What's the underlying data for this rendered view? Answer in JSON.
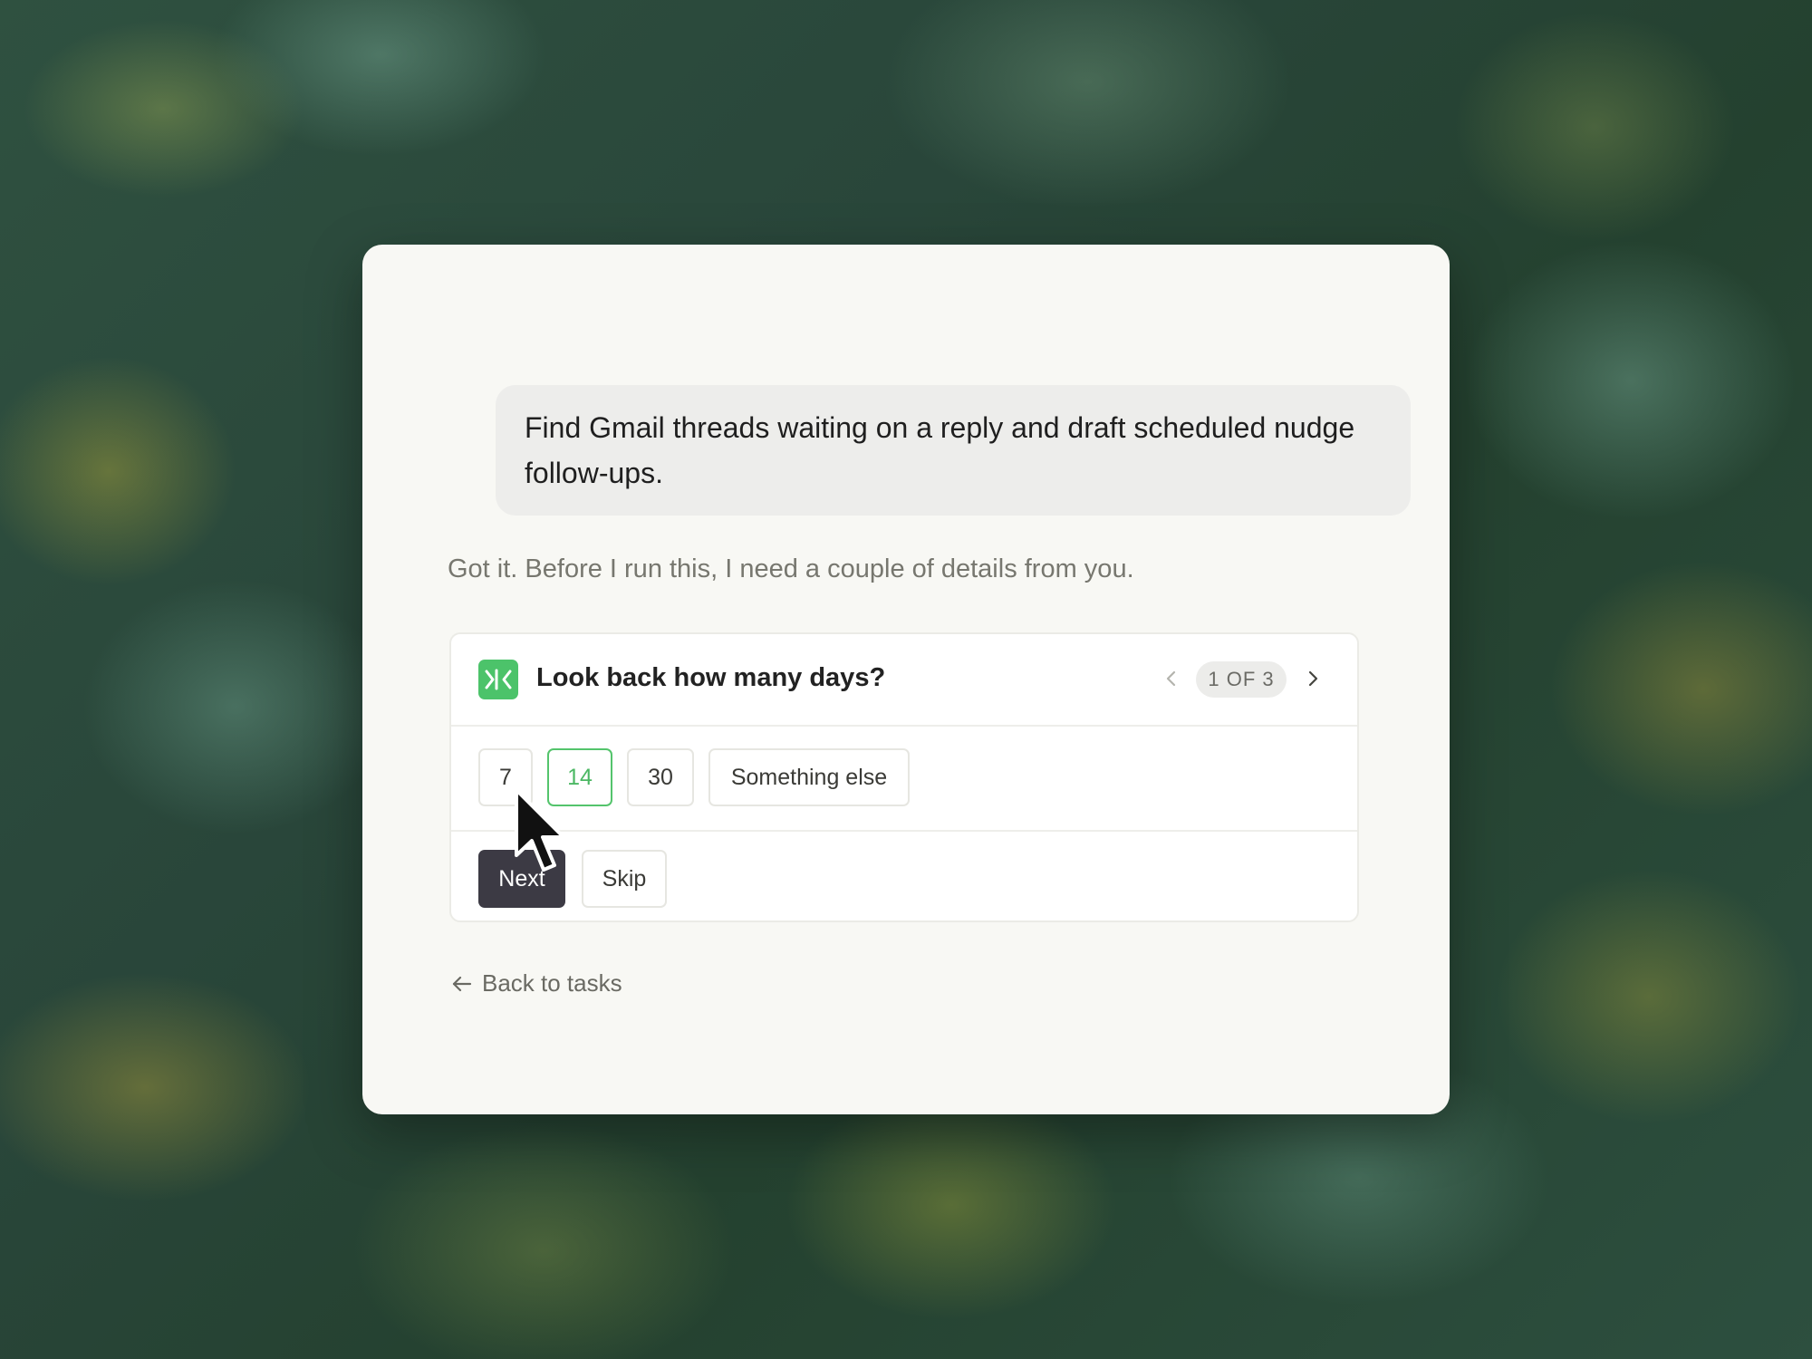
{
  "conversation": {
    "user_message": "Find Gmail threads waiting on a reply and draft scheduled nudge follow-ups.",
    "assistant_message": "Got it. Before I run this, I need a couple of details from you."
  },
  "question_card": {
    "app_icon": "app-logo-icon",
    "title": "Look back how many days?",
    "pager": {
      "prev_icon": "chevron-left-icon",
      "count_label": "1 OF 3",
      "next_icon": "chevron-right-icon"
    },
    "options": [
      {
        "label": "7",
        "selected": false
      },
      {
        "label": "14",
        "selected": true
      },
      {
        "label": "30",
        "selected": false
      },
      {
        "label": "Something else",
        "selected": false
      }
    ],
    "actions": {
      "next_label": "Next",
      "skip_label": "Skip"
    }
  },
  "footer": {
    "back_icon": "arrow-left-icon",
    "back_label": "Back to tasks"
  },
  "colors": {
    "accent_green": "#4cc36a",
    "primary_button": "#3c3a44",
    "panel_background": "#f8f8f4"
  }
}
